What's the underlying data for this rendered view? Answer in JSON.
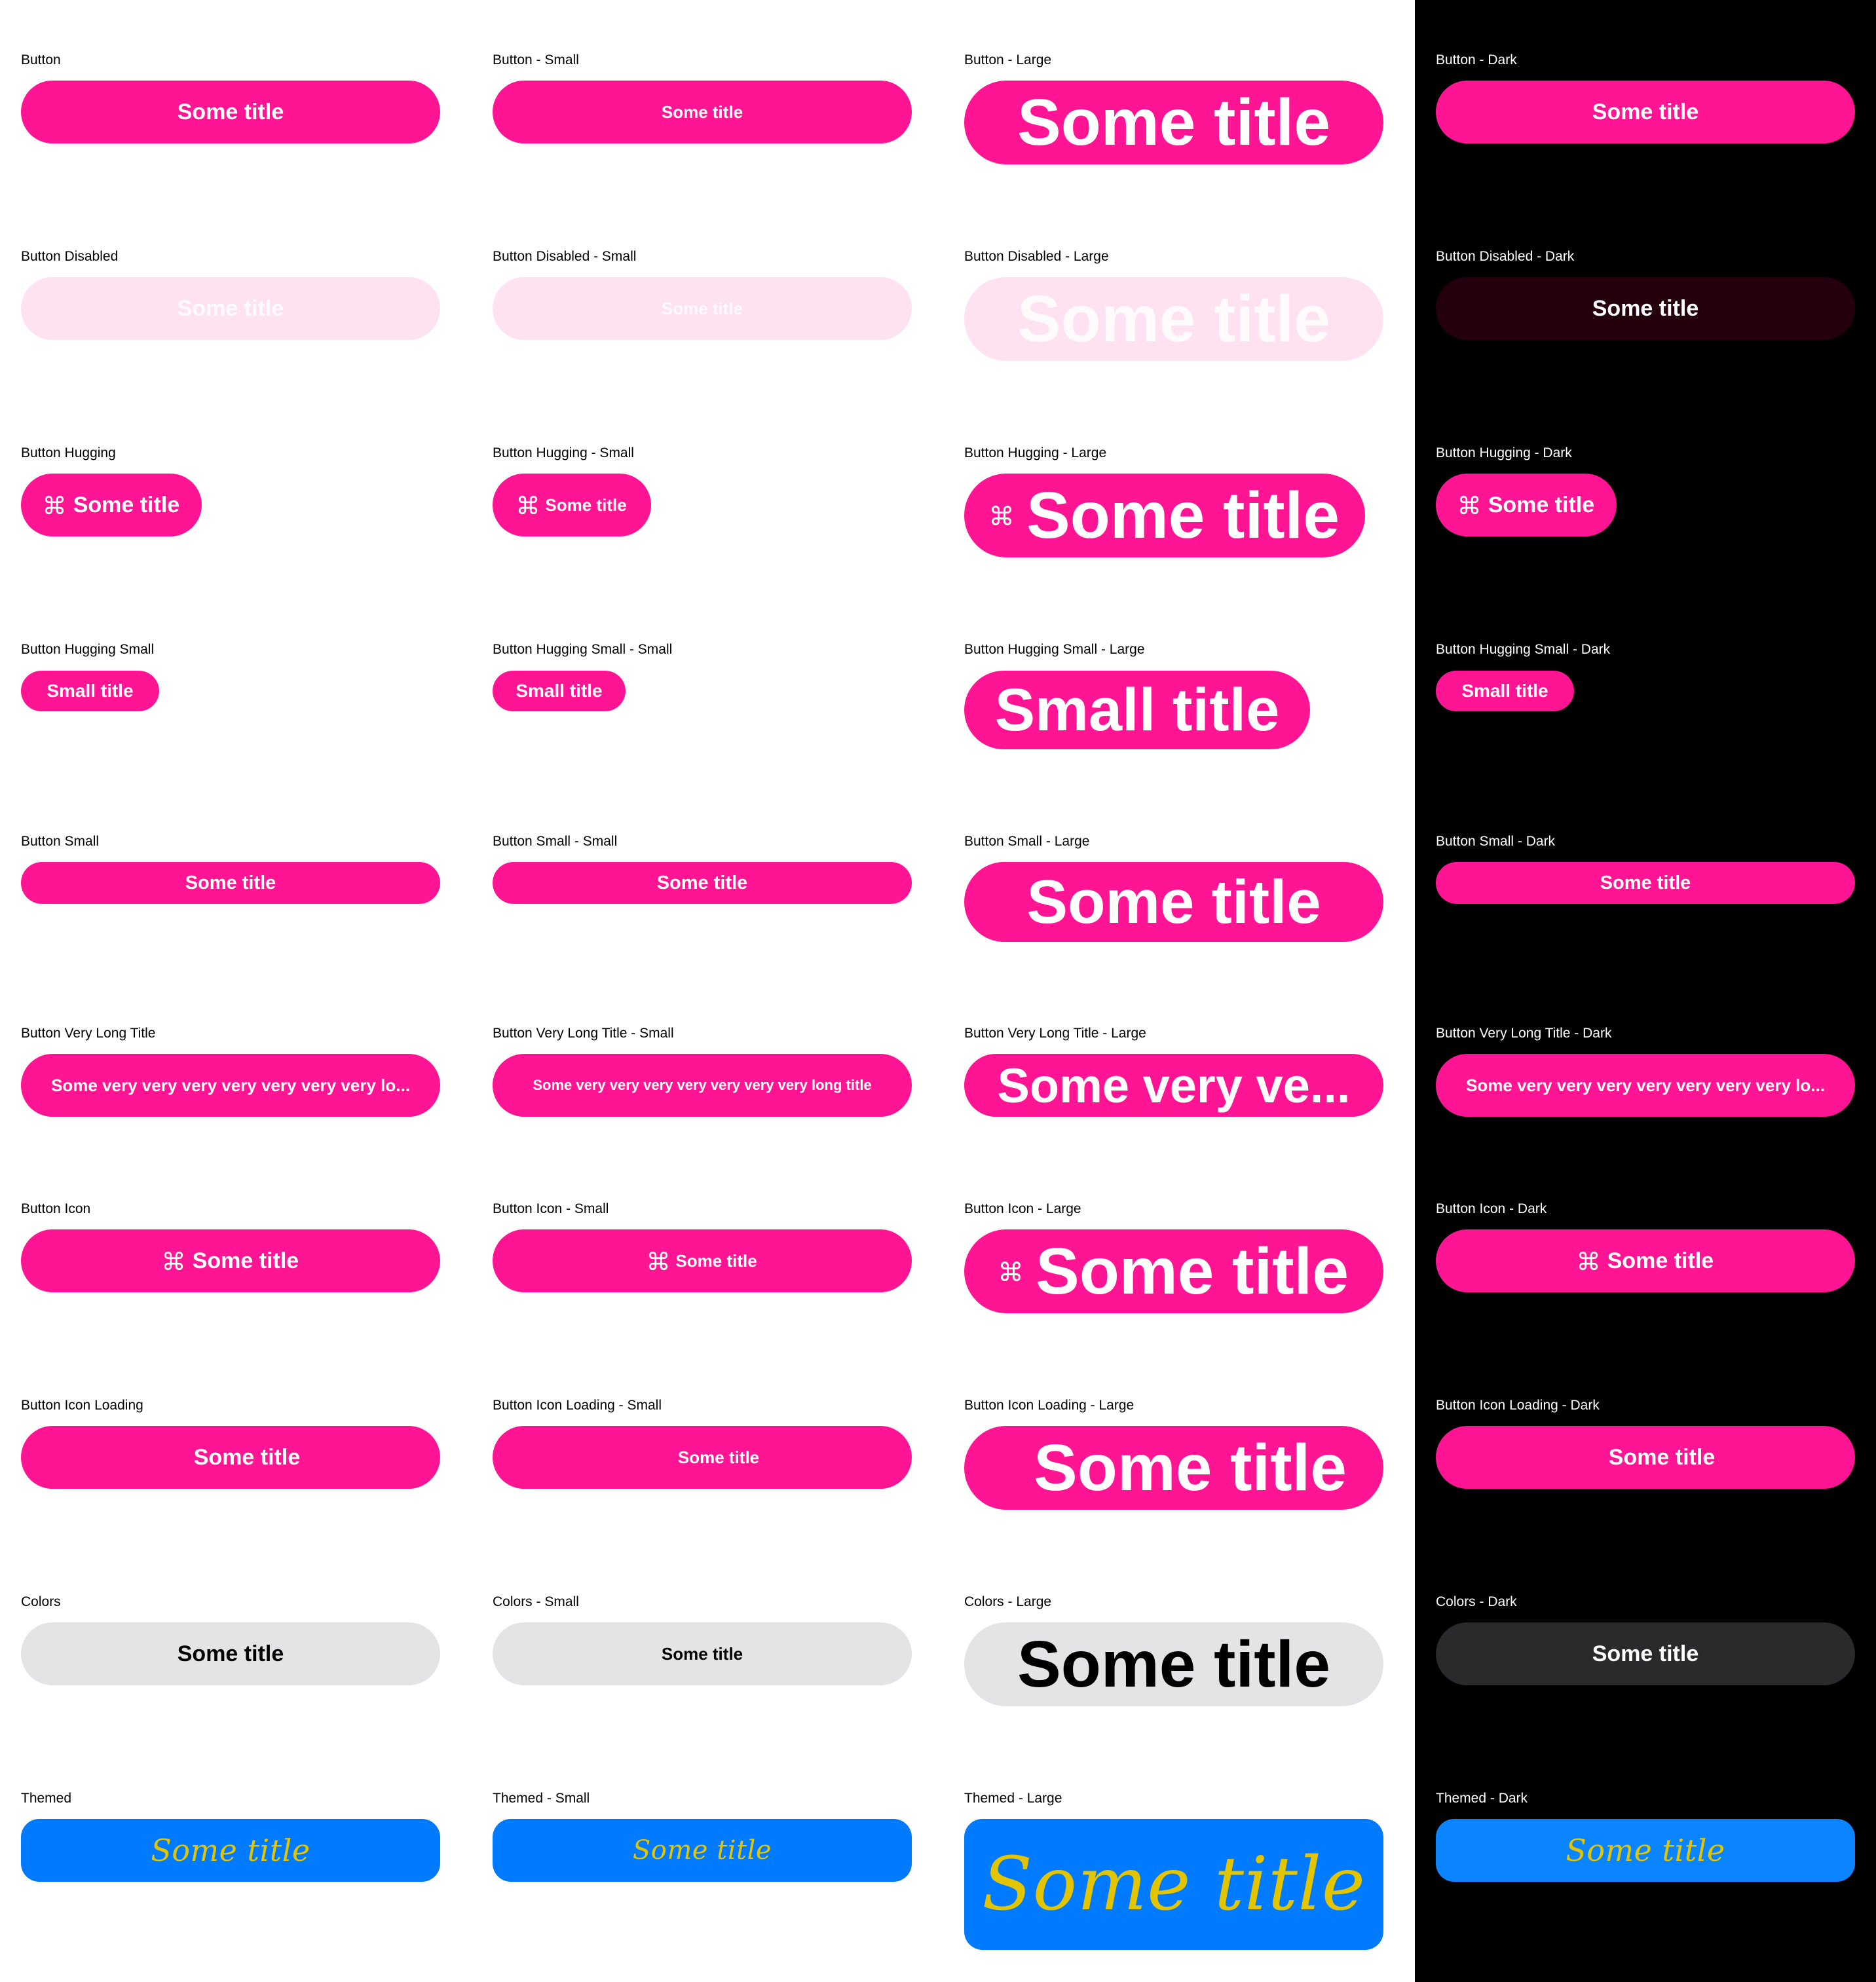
{
  "labels": {
    "r1": [
      "Button",
      "Button - Small",
      "Button - Large",
      "Button - Dark"
    ],
    "r2": [
      "Button Disabled",
      "Button Disabled - Small",
      "Button Disabled - Large",
      "Button Disabled - Dark"
    ],
    "r3": [
      "Button Hugging",
      "Button Hugging - Small",
      "Button Hugging - Large",
      "Button Hugging - Dark"
    ],
    "r4": [
      "Button Hugging Small",
      "Button Hugging Small - Small",
      "Button Hugging Small - Large",
      "Button Hugging Small - Dark"
    ],
    "r5": [
      "Button Small",
      "Button Small - Small",
      "Button Small - Large",
      "Button Small - Dark"
    ],
    "r6": [
      "Button Very Long Title",
      "Button Very Long Title - Small",
      "Button Very Long Title - Large",
      "Button Very Long Title - Dark"
    ],
    "r7": [
      "Button Icon",
      "Button Icon - Small",
      "Button Icon - Large",
      "Button Icon - Dark"
    ],
    "r8": [
      "Button Icon Loading",
      "Button Icon Loading - Small",
      "Button Icon Loading - Large",
      "Button Icon Loading - Dark"
    ],
    "r9": [
      "Colors",
      "Colors - Small",
      "Colors - Large",
      "Colors - Dark"
    ],
    "r10": [
      "Themed",
      "Themed - Small",
      "Themed - Large",
      "Themed - Dark"
    ]
  },
  "buttons": {
    "some_title": "Some title",
    "small_title": "Small title",
    "long_title": "Some very very very very very very very long title",
    "long_title_truncated": "Some very very very very very very very lo...",
    "long_title_large": "Some very ve..."
  },
  "icon": "command-icon",
  "colors": {
    "accent": "#ff1493",
    "disabled_light": "#ffe2f1",
    "disabled_dark": "#24000f",
    "gray_light": "#e4e4e6",
    "gray_dark": "#2a2a2c",
    "themed_bg": "#007aff",
    "themed_text": "#e2c500",
    "dark_background": "#000000"
  }
}
